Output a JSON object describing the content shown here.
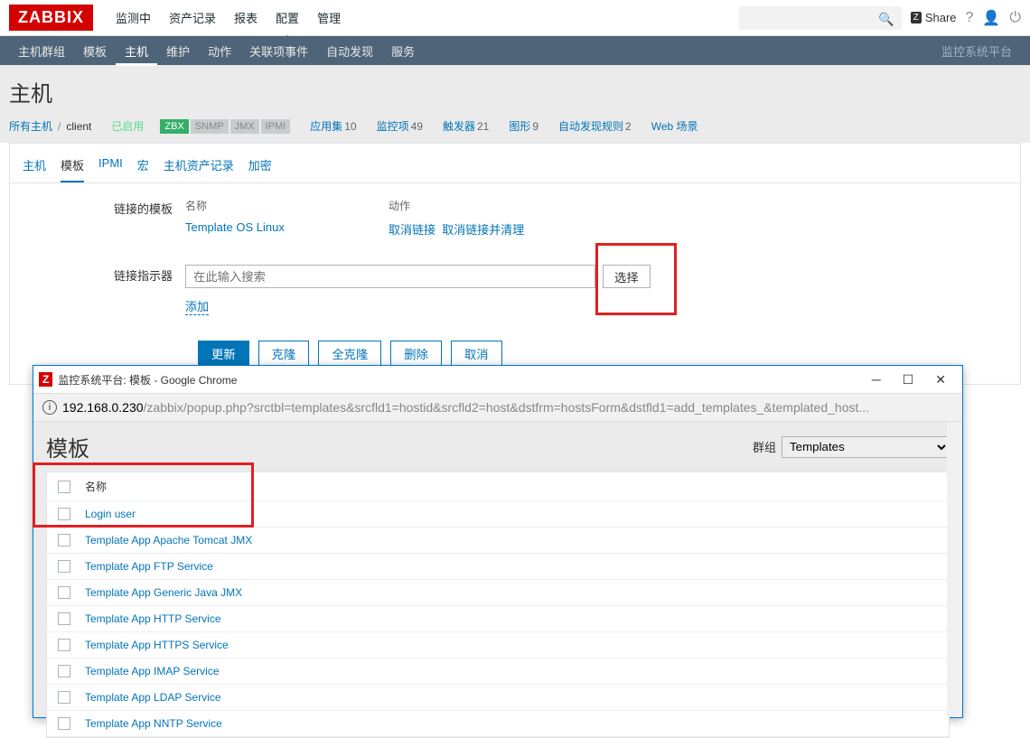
{
  "logo": "ZABBIX",
  "top_menu": [
    "监测中",
    "资产记录",
    "报表",
    "配置",
    "管理"
  ],
  "top_menu_active": 3,
  "share_label": "Share",
  "sub_menu": [
    "主机群组",
    "模板",
    "主机",
    "维护",
    "动作",
    "关联项事件",
    "自动发现",
    "服务"
  ],
  "sub_menu_active": 2,
  "sub_right": "监控系统平台",
  "page_title": "主机",
  "breadcrumb": {
    "all_hosts": "所有主机",
    "host": "client"
  },
  "status": {
    "enabled": "已启用",
    "zbx": "ZBX",
    "snmp": "SNMP",
    "jmx": "JMX",
    "ipmi": "IPMI"
  },
  "stats": [
    {
      "label": "应用集",
      "count": "10"
    },
    {
      "label": "监控项",
      "count": "49"
    },
    {
      "label": "触发器",
      "count": "21"
    },
    {
      "label": "图形",
      "count": "9"
    },
    {
      "label": "自动发现规则",
      "count": "2"
    },
    {
      "label": "Web 场景",
      "count": ""
    }
  ],
  "tabs": [
    "主机",
    "模板",
    "IPMI",
    "宏",
    "主机资产记录",
    "加密"
  ],
  "tabs_active": 1,
  "form": {
    "linked_label": "链接的模板",
    "col_name": "名称",
    "col_action": "动作",
    "linked_template": "Template OS Linux",
    "unlink": "取消链接",
    "unlink_clear": "取消链接并清理",
    "indicator_label": "链接指示器",
    "search_placeholder": "在此输入搜索",
    "select_btn": "选择",
    "add_link": "添加"
  },
  "buttons": {
    "update": "更新",
    "clone": "克隆",
    "full_clone": "全克隆",
    "delete": "删除",
    "cancel": "取消"
  },
  "popup": {
    "title": "监控系统平台: 模板 - Google Chrome",
    "url_host": "192.168.0.230",
    "url_path": "/zabbix/popup.php?srctbl=templates&srcfld1=hostid&srcfld2=host&dstfrm=hostsForm&dstfld1=add_templates_&templated_host...",
    "heading": "模板",
    "group_label": "群组",
    "group_value": "Templates",
    "col_name": "名称",
    "items": [
      "Login user",
      "Template App Apache Tomcat JMX",
      "Template App FTP Service",
      "Template App Generic Java JMX",
      "Template App HTTP Service",
      "Template App HTTPS Service",
      "Template App IMAP Service",
      "Template App LDAP Service",
      "Template App NNTP Service"
    ]
  }
}
